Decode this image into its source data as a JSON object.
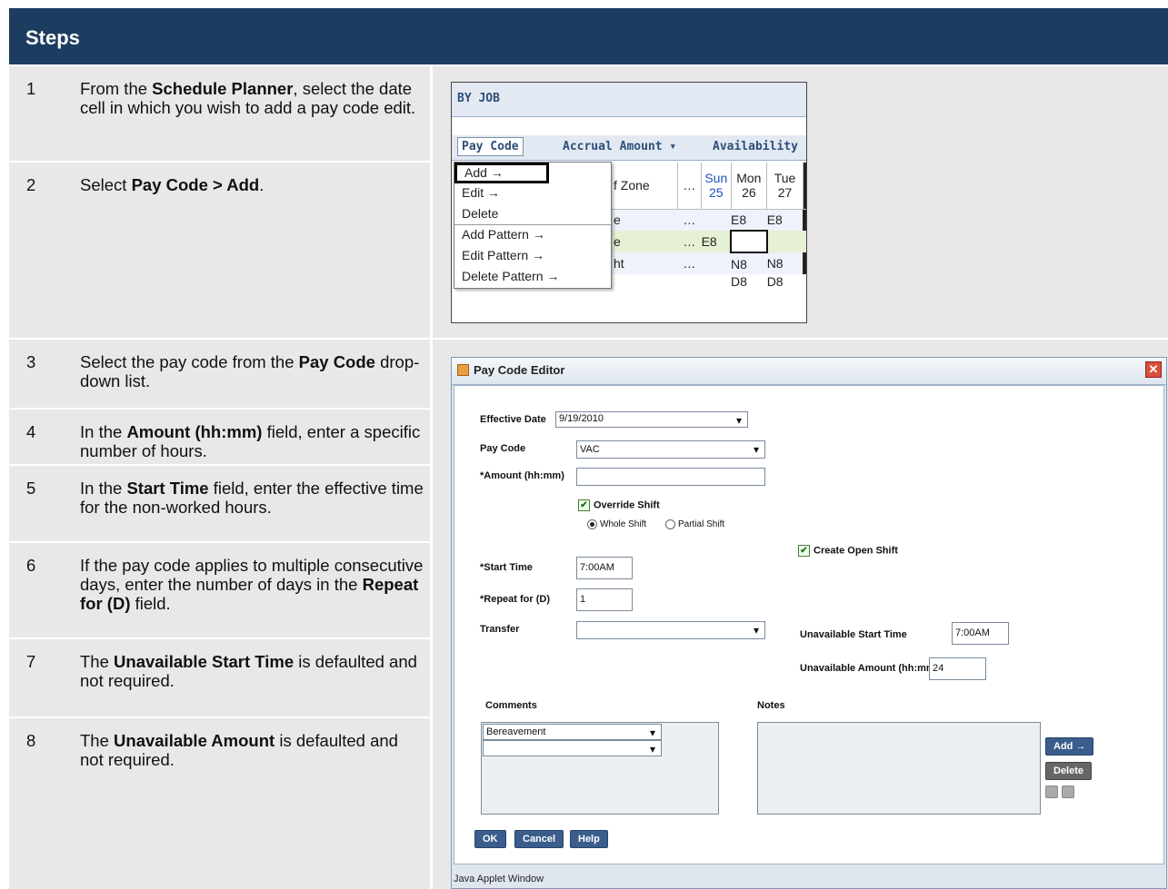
{
  "header": "Steps",
  "steps": [
    {
      "n": "1",
      "html_parts": [
        "From the ",
        "Schedule Planner",
        ", select the date cell in which you wish to add a pay code edit."
      ]
    },
    {
      "n": "2",
      "html_parts": [
        "Select ",
        "Pay Code > Add",
        "."
      ]
    },
    {
      "n": "3",
      "html_parts": [
        "Select the pay code from the ",
        "Pay Code",
        " drop-down list."
      ]
    },
    {
      "n": "4",
      "html_parts": [
        "In the ",
        "Amount (hh:mm)",
        " field, enter a specific number of hours."
      ]
    },
    {
      "n": "5",
      "html_parts": [
        "In the ",
        "Start Time",
        " field, enter the effective time for the non-worked hours."
      ]
    },
    {
      "n": "6",
      "html_parts": [
        "If the pay code applies to multiple consecutive days, enter the number of days in the ",
        "Repeat for (D)",
        " field."
      ]
    },
    {
      "n": "7",
      "html_parts": [
        "The ",
        "Unavailable Start Time",
        " is defaulted and not required."
      ]
    },
    {
      "n": "8",
      "html_parts": [
        "The ",
        "Unavailable Amount",
        " is defaulted and not required."
      ]
    }
  ],
  "planner": {
    "title": "BY JOB",
    "menus": [
      "Pay Code",
      "Accrual Amount ▾",
      "Availability"
    ],
    "dropdown": [
      "Add →",
      "Edit →",
      "Delete",
      "Add Pattern →",
      "Edit Pattern →",
      "Delete Pattern →"
    ],
    "col_partial": "f Zone",
    "days": [
      {
        "d": "Sun",
        "n": "25"
      },
      {
        "d": "Mon",
        "n": "26"
      },
      {
        "d": "Tue",
        "n": "27"
      }
    ],
    "rows": [
      [
        "e",
        "",
        "E8",
        "E8"
      ],
      [
        "e",
        "E8",
        "",
        ""
      ],
      [
        "ht",
        "",
        "N8",
        "N8"
      ],
      [
        "",
        "",
        "D8",
        "D8"
      ]
    ]
  },
  "editor": {
    "title": "Pay Code Editor",
    "effective_date_label": "Effective Date",
    "effective_date": "9/19/2010",
    "pay_code_label": "Pay Code",
    "pay_code": "VAC",
    "amount_label": "*Amount (hh:mm)",
    "amount": "",
    "override_shift": "Override Shift",
    "whole_shift": "Whole Shift",
    "partial_shift": "Partial Shift",
    "create_open_shift": "Create Open Shift",
    "start_time_label": "*Start Time",
    "start_time": "7:00AM",
    "repeat_label": "*Repeat for (D)",
    "repeat": "1",
    "transfer_label": "Transfer",
    "transfer": "",
    "unavail_start_label": "Unavailable Start Time",
    "unavail_start": "7:00AM",
    "unavail_amount_label": "Unavailable Amount (hh:mm)",
    "unavail_amount": "24",
    "comments_label": "Comments",
    "comment_1": "Bereavement",
    "comment_2": "",
    "notes_label": "Notes",
    "add_btn": "Add →",
    "delete_btn": "Delete",
    "ok_btn": "OK",
    "cancel_btn": "Cancel",
    "help_btn": "Help",
    "status": "Java Applet Window"
  }
}
